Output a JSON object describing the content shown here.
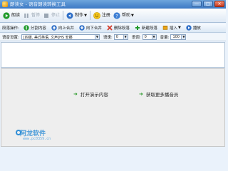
{
  "window": {
    "title": "朗读女 - 语音朗读转换工具",
    "controls": [
      "—",
      "□",
      "×"
    ]
  },
  "toolbar": {
    "play": "朗读",
    "pause": "暂停",
    "stop": "停止",
    "make": "制作",
    "register": "注册",
    "help": "帮助"
  },
  "ops": {
    "label": "段落操作:",
    "split": "分割内容",
    "merge_up": "向上合并",
    "merge_down": "向下合并",
    "delete": "删除段落",
    "new": "新建段落",
    "insert": "插入",
    "play": "播放"
  },
  "settings": {
    "voice_label": "语音设置:",
    "voice_value": "[四版, 美式英语, 文声]HS 安娜",
    "speed_label": "语速:",
    "speed_value": "0",
    "pitch_label": "语调:",
    "pitch_value": "0",
    "volume_label": "音量:",
    "volume_value": "100"
  },
  "links": {
    "open": "打开演示内容",
    "more": "获取更多播音员"
  },
  "watermark": {
    "main": "阿龙软件",
    "sub": "www.pc0359.cn"
  },
  "colors": {
    "accent": "#3b78c4",
    "play_green": "#1f9a2a",
    "stop_red": "#d23a2a",
    "blue_arrow": "#2f6fc7",
    "link_green": "#2a9a2a"
  }
}
